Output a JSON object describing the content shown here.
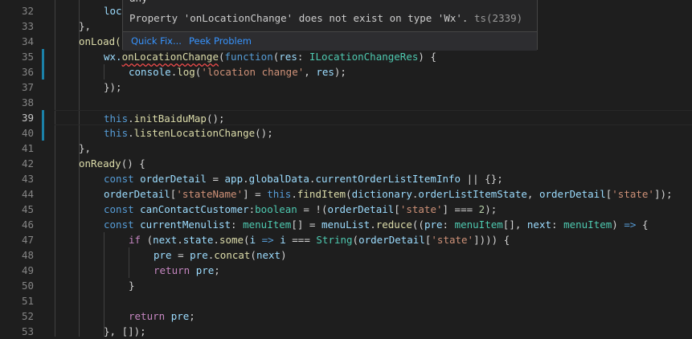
{
  "gutter": {
    "line_numbers": [
      "32",
      "33",
      "34",
      "35",
      "36",
      "37",
      "38",
      "39",
      "40",
      "41",
      "42",
      "43",
      "44",
      "45",
      "46",
      "47",
      "48",
      "49",
      "50",
      "51",
      "52",
      "53"
    ]
  },
  "code": {
    "l32": "loc",
    "l33": "},",
    "l34": "onLoad(",
    "l35a": "wx.",
    "l35b": "onLocationChange",
    "l35c": "(",
    "l35d": "function",
    "l35e": "(",
    "l35f": "res",
    "l35g": ": ",
    "l35h": "ILocationChangeRes",
    "l35i": ") {",
    "l36a": "console",
    "l36b": ".",
    "l36c": "log",
    "l36d": "(",
    "l36e": "'location change'",
    "l36f": ", ",
    "l36g": "res",
    "l36h": ");",
    "l37": "});",
    "l39a": "this",
    "l39b": ".",
    "l39c": "initBaiduMap",
    "l39d": "();",
    "l40a": "this",
    "l40b": ".",
    "l40c": "listenLocationChange",
    "l40d": "();",
    "l41": "},",
    "l42a": "onReady",
    "l42b": "() {",
    "l43a": "const ",
    "l43b": "orderDetail",
    "l43c": " = ",
    "l43d": "app",
    "l43e": ".",
    "l43f": "globalData",
    "l43g": ".",
    "l43h": "currentOrderListItemInfo",
    "l43i": " || {};",
    "l44a": "orderDetail",
    "l44b": "[",
    "l44c": "'stateName'",
    "l44d": "] = ",
    "l44e": "this",
    "l44f": ".",
    "l44g": "findItem",
    "l44h": "(",
    "l44i": "dictionary",
    "l44j": ".",
    "l44k": "orderListItemState",
    "l44l": ", ",
    "l44m": "orderDetail",
    "l44n": "[",
    "l44o": "'state'",
    "l44p": "]);",
    "l45a": "const ",
    "l45b": "canContactCustomer",
    "l45c": ":",
    "l45d": "boolean",
    "l45e": " = !(",
    "l45f": "orderDetail",
    "l45g": "[",
    "l45h": "'state'",
    "l45i": "] === ",
    "l45j": "2",
    "l45k": ");",
    "l46a": "const ",
    "l46b": "currentMenulist",
    "l46c": ": ",
    "l46d": "menuItem",
    "l46e": "[] = ",
    "l46f": "menuList",
    "l46g": ".",
    "l46h": "reduce",
    "l46i": "((",
    "l46j": "pre",
    "l46k": ": ",
    "l46l": "menuItem",
    "l46m": "[], ",
    "l46n": "next",
    "l46o": ": ",
    "l46p": "menuItem",
    "l46q": ") ",
    "l46r": "=>",
    "l46s": " {",
    "l47a": "if",
    "l47b": " (",
    "l47c": "next",
    "l47d": ".",
    "l47e": "state",
    "l47f": ".",
    "l47g": "some",
    "l47h": "(",
    "l47i": "i",
    "l47j": " => ",
    "l47k": "i",
    "l47l": " === ",
    "l47m": "String",
    "l47n": "(",
    "l47o": "orderDetail",
    "l47p": "[",
    "l47q": "'state'",
    "l47r": "]))) {",
    "l48a": "pre",
    "l48b": " = ",
    "l48c": "pre",
    "l48d": ".",
    "l48e": "concat",
    "l48f": "(",
    "l48g": "next",
    "l48h": ")",
    "l49a": "return ",
    "l49b": "pre",
    "l49c": ";",
    "l50": "}",
    "l52a": "return ",
    "l52b": "pre",
    "l52c": ";",
    "l53": "}, []);"
  },
  "hover": {
    "top_text": "any",
    "message": "Property 'onLocationChange' does not exist on type 'Wx'.",
    "code": "ts(2339)",
    "quick_fix": "Quick Fix...",
    "peek_problem": "Peek Problem"
  },
  "colors": {
    "background": "#1e1e1e",
    "keyword": "#569cd6",
    "function": "#dcdcaa",
    "variable": "#9cdcfe",
    "string": "#ce9178",
    "number": "#b5cea8",
    "type": "#4ec9b0",
    "control": "#c586c0",
    "error_squiggle": "#f14c4c",
    "link": "#3794ff",
    "modified_gutter": "#1b81a8"
  }
}
